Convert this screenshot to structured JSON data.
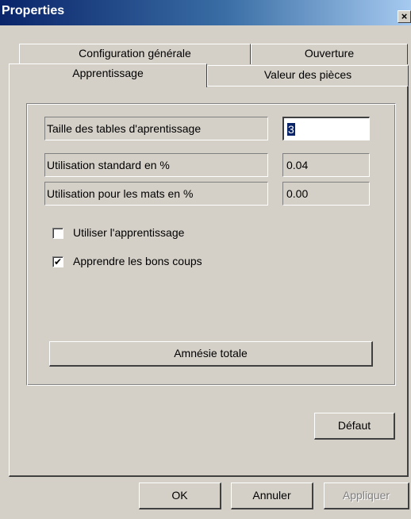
{
  "window": {
    "title": "Properties",
    "close_glyph": "×"
  },
  "tabs": {
    "back_row": [
      "Configuration générale",
      "Ouverture"
    ],
    "front_row": [
      "Apprentissage",
      "Valeur des pièces"
    ],
    "active": "Apprentissage"
  },
  "fields": [
    {
      "label": "Taille des tables d'aprentissage",
      "value": "3",
      "editable": true
    },
    {
      "label": "Utilisation standard en %",
      "value": "0.04",
      "editable": false
    },
    {
      "label": "Utilisation pour les mats en %",
      "value": "0.00",
      "editable": false
    }
  ],
  "checkboxes": [
    {
      "label": "Utiliser l'apprentissage",
      "checked": false
    },
    {
      "label": "Apprendre les bons coups",
      "checked": true
    }
  ],
  "check_glyph": "✔",
  "buttons": {
    "amnesia": "Amnésie totale",
    "default": "Défaut",
    "ok": "OK",
    "cancel": "Annuler",
    "apply": "Appliquer"
  }
}
